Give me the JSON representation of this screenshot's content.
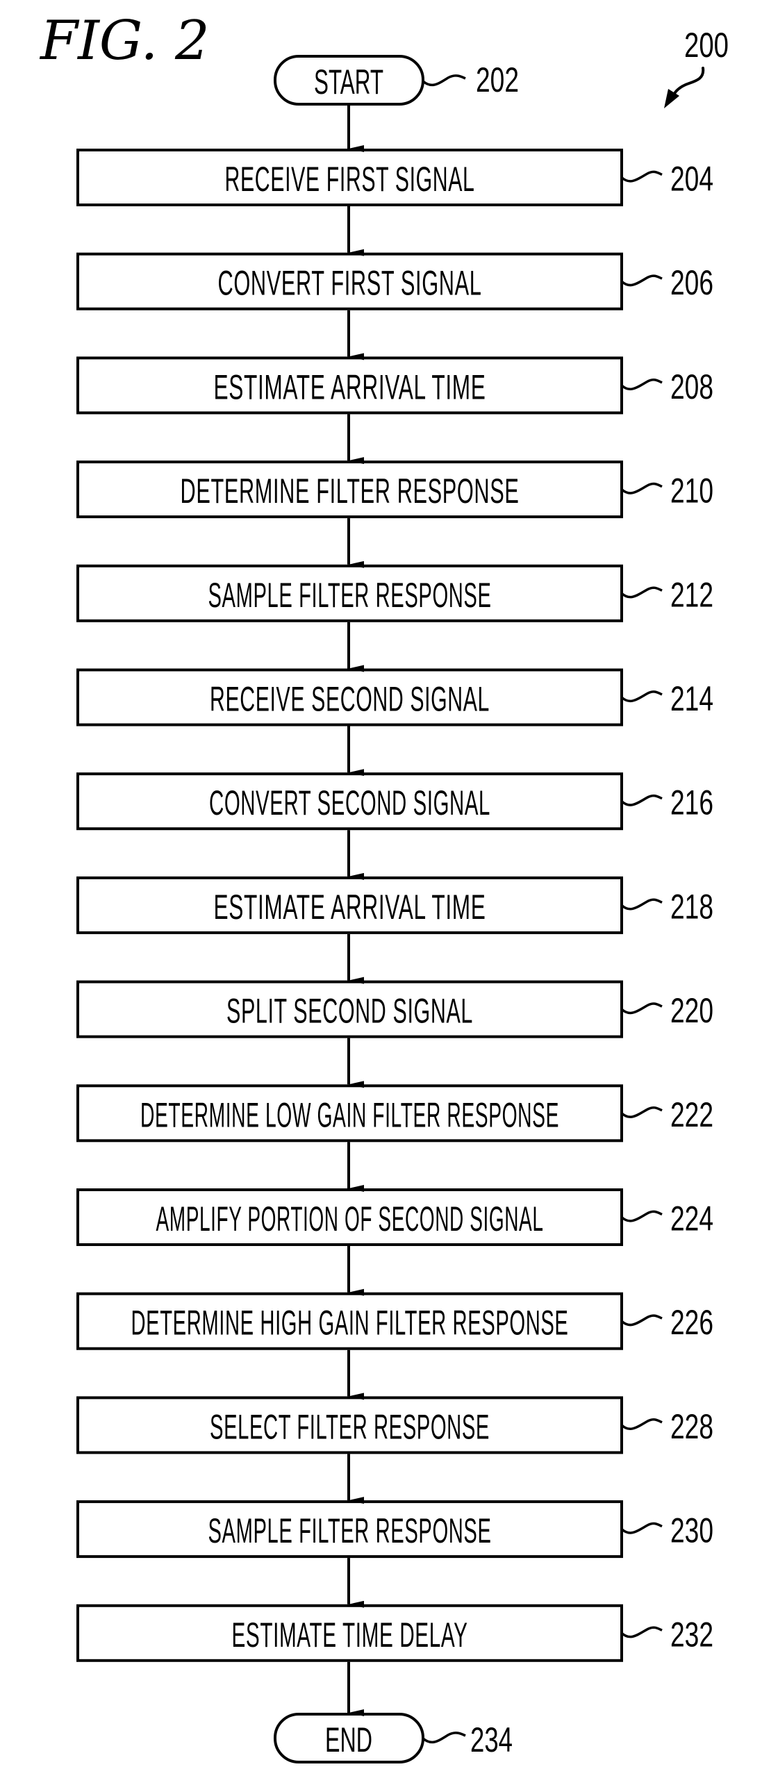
{
  "figure": {
    "title": "FIG. 2",
    "reference": "200"
  },
  "start": {
    "label": "START",
    "reference": "202"
  },
  "steps": [
    {
      "label": "RECEIVE FIRST SIGNAL",
      "reference": "204"
    },
    {
      "label": "CONVERT FIRST SIGNAL",
      "reference": "206"
    },
    {
      "label": "ESTIMATE ARRIVAL TIME",
      "reference": "208"
    },
    {
      "label": "DETERMINE FILTER RESPONSE",
      "reference": "210"
    },
    {
      "label": "SAMPLE FILTER RESPONSE",
      "reference": "212"
    },
    {
      "label": "RECEIVE SECOND SIGNAL",
      "reference": "214"
    },
    {
      "label": "CONVERT SECOND SIGNAL",
      "reference": "216"
    },
    {
      "label": "ESTIMATE ARRIVAL TIME",
      "reference": "218"
    },
    {
      "label": "SPLIT SECOND SIGNAL",
      "reference": "220"
    },
    {
      "label": "DETERMINE LOW GAIN FILTER RESPONSE",
      "reference": "222"
    },
    {
      "label": "AMPLIFY PORTION OF SECOND SIGNAL",
      "reference": "224"
    },
    {
      "label": "DETERMINE HIGH GAIN FILTER RESPONSE",
      "reference": "226"
    },
    {
      "label": "SELECT FILTER RESPONSE",
      "reference": "228"
    },
    {
      "label": "SAMPLE FILTER RESPONSE",
      "reference": "230"
    },
    {
      "label": "ESTIMATE TIME DELAY",
      "reference": "232"
    }
  ],
  "end": {
    "label": "END",
    "reference": "234"
  }
}
